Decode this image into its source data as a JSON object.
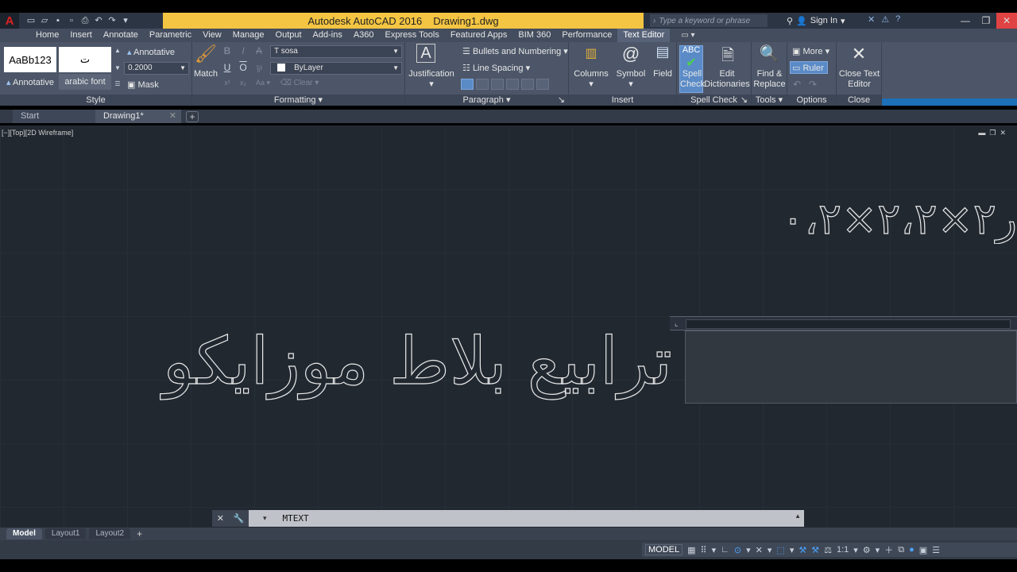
{
  "titlebar": {
    "app_name": "Autodesk AutoCAD 2016",
    "file_name": "Drawing1.dwg",
    "search_placeholder": "Type a keyword or phrase",
    "sign_in": "Sign In"
  },
  "ribbon_tabs": [
    {
      "label": "Home"
    },
    {
      "label": "Insert"
    },
    {
      "label": "Annotate"
    },
    {
      "label": "Parametric"
    },
    {
      "label": "View"
    },
    {
      "label": "Manage"
    },
    {
      "label": "Output"
    },
    {
      "label": "Add-ins"
    },
    {
      "label": "A360"
    },
    {
      "label": "Express Tools"
    },
    {
      "label": "Featured Apps"
    },
    {
      "label": "BIM 360"
    },
    {
      "label": "Performance"
    },
    {
      "label": "Text Editor"
    }
  ],
  "ribbon": {
    "style": {
      "title": "Style",
      "preview1": "AaBb123",
      "preview2": "ت",
      "annotative": "Annotative",
      "font_name": "arabic font"
    },
    "formatting": {
      "title": "Formatting",
      "annotative": "Annotative",
      "height": "0.2000",
      "mask": "Mask",
      "match": "Match",
      "font": "sosa",
      "color": "ByLayer",
      "bold": "B",
      "italic": "I",
      "strike": "A",
      "underline": "U",
      "overline": "O",
      "case": "Aa",
      "clear": "Clear"
    },
    "paragraph": {
      "title": "Paragraph",
      "justification": "Justification",
      "bullets": "Bullets and Numbering",
      "line_spacing": "Line Spacing"
    },
    "insert": {
      "title": "Insert",
      "columns": "Columns",
      "symbol": "Symbol",
      "field": "Field"
    },
    "spell_check": {
      "title": "Spell Check",
      "spell_check": "Spell Check",
      "edit_dictionaries": "Edit Dictionaries"
    },
    "tools": {
      "title": "Tools",
      "find_replace": "Find & Replace"
    },
    "options": {
      "title": "Options",
      "more": "More",
      "ruler": "Ruler"
    },
    "close": {
      "title": "Close",
      "close_editor": "Close Text Editor"
    }
  },
  "file_tabs": [
    {
      "label": "Start"
    },
    {
      "label": "Drawing1*"
    }
  ],
  "drawing": {
    "viewport_label": "[−][Top][2D Wireframe]",
    "top_text": "ر٢×٢،٢×٠،٢ر",
    "main_text": "ترابيع بلاط موزايكو"
  },
  "command_line": {
    "command": "MTEXT"
  },
  "layout_tabs": [
    {
      "label": "Model"
    },
    {
      "label": "Layout1"
    },
    {
      "label": "Layout2"
    }
  ],
  "status_bar": {
    "model": "MODEL",
    "scale": "1:1"
  }
}
